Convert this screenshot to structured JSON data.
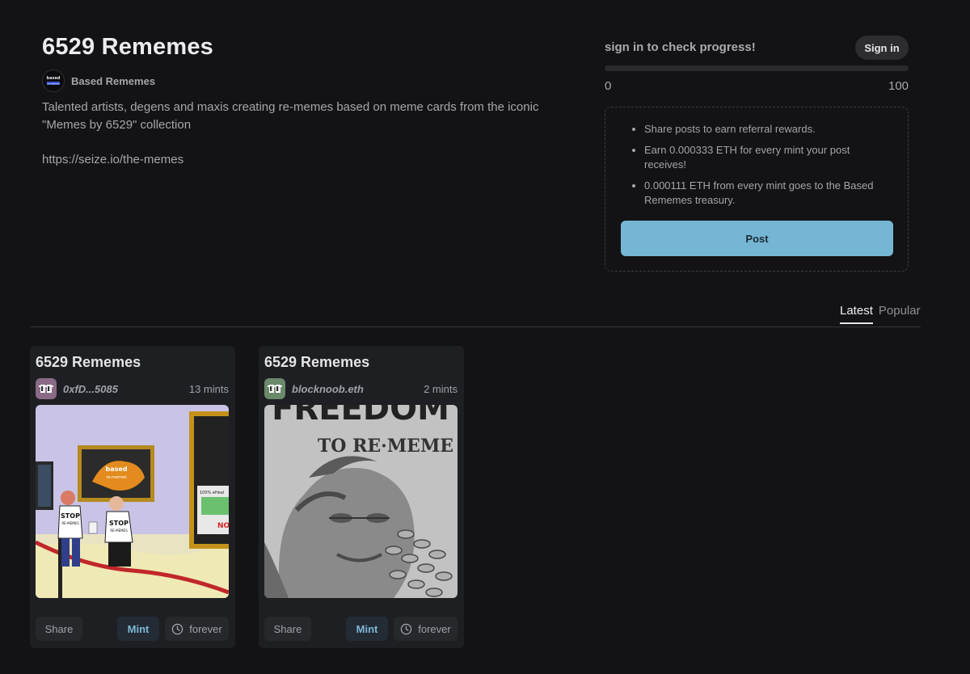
{
  "collection": {
    "title": "6529 Rememes",
    "creator_name": "Based Rememes",
    "creator_avatar_text": "based re-memes",
    "description": "Talented artists, degens and maxis creating re-memes based on meme cards from the iconic \"Memes by 6529\" collection",
    "link": "https://seize.io/the-memes"
  },
  "progress": {
    "label": "sign in to check progress!",
    "signin_label": "Sign in",
    "min_label": "0",
    "max_label": "100",
    "value": 0
  },
  "info": {
    "items": [
      "Share posts to earn referral rewards.",
      "Earn 0.000333 ETH for every mint your post receives!",
      "0.000111 ETH from every mint goes to the Based Rememes treasury."
    ],
    "post_label": "Post"
  },
  "tabs": [
    {
      "label": "Latest",
      "active": true
    },
    {
      "label": "Popular",
      "active": false
    }
  ],
  "posts": [
    {
      "title": "6529 Rememes",
      "author": "0xfD...5085",
      "mints": "13 mints",
      "avatar_color": "#8a6a86",
      "image": {
        "description_icon": "museum-protest-artwork",
        "sign_text": "based",
        "sign_subtext": "re-memes",
        "shirt_text_1": "STOP",
        "shirt_text_1b": "RE-MEMES",
        "shirt_text_2": "STOP",
        "shirt_text_2b": "RE-MEMES",
        "poster_text": "100% eHeal",
        "poster_red": "NO"
      },
      "share_label": "Share",
      "mint_label": "Mint",
      "duration_label": "forever"
    },
    {
      "title": "6529 Rememes",
      "author": "blocknoob.eth",
      "mints": "2 mints",
      "avatar_color": "#6a8a6a",
      "image": {
        "description_icon": "freedom-to-rememe-artwork",
        "headline": "FREEDOM",
        "subline": "TO RE·MEME"
      },
      "share_label": "Share",
      "mint_label": "Mint",
      "duration_label": "forever"
    }
  ],
  "colors": {
    "background": "#131315",
    "accent": "#75b6d4",
    "card": "#1e1f23"
  }
}
